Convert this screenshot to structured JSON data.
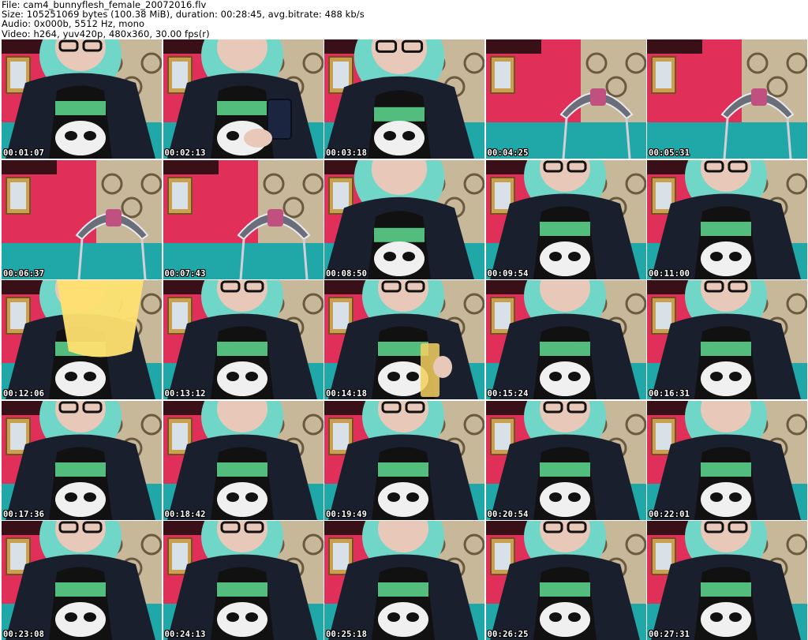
{
  "file_info": {
    "file_line": "File: cam4_bunnyflesh_female_20072016.flv",
    "size_line": "Size: 105251069 bytes (100.38 MiB), duration: 00:28:45, avg.bitrate: 488 kb/s",
    "audio_line": "Audio: 0x000b, 5512 Hz, mono",
    "video_line": "Video: h264, yuv420p, 480x360, 30.00 fps(r)"
  },
  "colors": {
    "wall_pink": "#e0305a",
    "wall_dark": "#3a1018",
    "curtain": "#c8b89a",
    "curtain_dark": "#6b5a40",
    "bed_teal": "#20a8a8",
    "hoodie": "#1a1f2e",
    "hair": "#6fd6c8",
    "skin": "#e8c8b8",
    "shirt_green": "#5bd08a",
    "frame_gold": "#c8a050",
    "chair_grey": "#6a6e78",
    "timestamp_text": "#ffffff"
  },
  "thumbnails": [
    {
      "timestamp": "00:01:07",
      "scene": "person"
    },
    {
      "timestamp": "00:02:13",
      "scene": "person-phone"
    },
    {
      "timestamp": "00:03:18",
      "scene": "person-close"
    },
    {
      "timestamp": "00:04:25",
      "scene": "chair"
    },
    {
      "timestamp": "00:05:31",
      "scene": "chair"
    },
    {
      "timestamp": "00:06:37",
      "scene": "chair"
    },
    {
      "timestamp": "00:07:43",
      "scene": "chair"
    },
    {
      "timestamp": "00:08:50",
      "scene": "person-close"
    },
    {
      "timestamp": "00:09:54",
      "scene": "person"
    },
    {
      "timestamp": "00:11:00",
      "scene": "person"
    },
    {
      "timestamp": "00:12:06",
      "scene": "person-cup"
    },
    {
      "timestamp": "00:13:12",
      "scene": "person"
    },
    {
      "timestamp": "00:14:18",
      "scene": "person-drink"
    },
    {
      "timestamp": "00:15:24",
      "scene": "person"
    },
    {
      "timestamp": "00:16:31",
      "scene": "person"
    },
    {
      "timestamp": "00:17:36",
      "scene": "person"
    },
    {
      "timestamp": "00:18:42",
      "scene": "person"
    },
    {
      "timestamp": "00:19:49",
      "scene": "person"
    },
    {
      "timestamp": "00:20:54",
      "scene": "person"
    },
    {
      "timestamp": "00:22:01",
      "scene": "person"
    },
    {
      "timestamp": "00:23:08",
      "scene": "person"
    },
    {
      "timestamp": "00:24:13",
      "scene": "person"
    },
    {
      "timestamp": "00:25:18",
      "scene": "person"
    },
    {
      "timestamp": "00:26:25",
      "scene": "person"
    },
    {
      "timestamp": "00:27:31",
      "scene": "person"
    }
  ]
}
